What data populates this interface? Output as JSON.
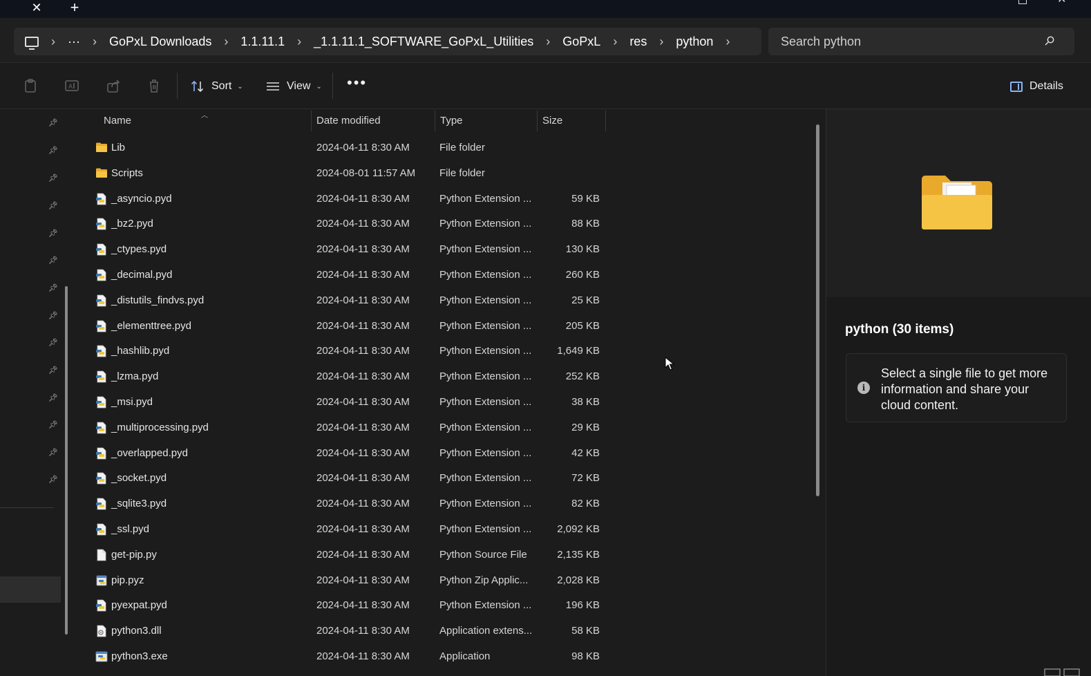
{
  "titlebar": {
    "close_tab_glyph": "✕",
    "new_tab_glyph": "+"
  },
  "address": {
    "more_glyph": "···",
    "breadcrumbs": [
      "GoPxL Downloads",
      "1.1.11.1",
      "_1.1.11.1_SOFTWARE_GoPxL_Utilities",
      "GoPxL",
      "res",
      "python"
    ],
    "separator": "›"
  },
  "search": {
    "placeholder": "Search python"
  },
  "toolbar": {
    "sort_label": "Sort",
    "view_label": "View",
    "more_label": "•••",
    "details_label": "Details"
  },
  "columns": {
    "name": "Name",
    "date": "Date modified",
    "type": "Type",
    "size": "Size"
  },
  "files": [
    {
      "name": "Lib",
      "date": "2024-04-11 8:30 AM",
      "type": "File folder",
      "size": "",
      "icon": "folder-icon"
    },
    {
      "name": "Scripts",
      "date": "2024-08-01 11:57 AM",
      "type": "File folder",
      "size": "",
      "icon": "folder-icon"
    },
    {
      "name": "_asyncio.pyd",
      "date": "2024-04-11 8:30 AM",
      "type": "Python Extension ...",
      "size": "59 KB",
      "icon": "python-file-icon"
    },
    {
      "name": "_bz2.pyd",
      "date": "2024-04-11 8:30 AM",
      "type": "Python Extension ...",
      "size": "88 KB",
      "icon": "python-file-icon"
    },
    {
      "name": "_ctypes.pyd",
      "date": "2024-04-11 8:30 AM",
      "type": "Python Extension ...",
      "size": "130 KB",
      "icon": "python-file-icon"
    },
    {
      "name": "_decimal.pyd",
      "date": "2024-04-11 8:30 AM",
      "type": "Python Extension ...",
      "size": "260 KB",
      "icon": "python-file-icon"
    },
    {
      "name": "_distutils_findvs.pyd",
      "date": "2024-04-11 8:30 AM",
      "type": "Python Extension ...",
      "size": "25 KB",
      "icon": "python-file-icon"
    },
    {
      "name": "_elementtree.pyd",
      "date": "2024-04-11 8:30 AM",
      "type": "Python Extension ...",
      "size": "205 KB",
      "icon": "python-file-icon"
    },
    {
      "name": "_hashlib.pyd",
      "date": "2024-04-11 8:30 AM",
      "type": "Python Extension ...",
      "size": "1,649 KB",
      "icon": "python-file-icon"
    },
    {
      "name": "_lzma.pyd",
      "date": "2024-04-11 8:30 AM",
      "type": "Python Extension ...",
      "size": "252 KB",
      "icon": "python-file-icon"
    },
    {
      "name": "_msi.pyd",
      "date": "2024-04-11 8:30 AM",
      "type": "Python Extension ...",
      "size": "38 KB",
      "icon": "python-file-icon"
    },
    {
      "name": "_multiprocessing.pyd",
      "date": "2024-04-11 8:30 AM",
      "type": "Python Extension ...",
      "size": "29 KB",
      "icon": "python-file-icon"
    },
    {
      "name": "_overlapped.pyd",
      "date": "2024-04-11 8:30 AM",
      "type": "Python Extension ...",
      "size": "42 KB",
      "icon": "python-file-icon"
    },
    {
      "name": "_socket.pyd",
      "date": "2024-04-11 8:30 AM",
      "type": "Python Extension ...",
      "size": "72 KB",
      "icon": "python-file-icon"
    },
    {
      "name": "_sqlite3.pyd",
      "date": "2024-04-11 8:30 AM",
      "type": "Python Extension ...",
      "size": "82 KB",
      "icon": "python-file-icon"
    },
    {
      "name": "_ssl.pyd",
      "date": "2024-04-11 8:30 AM",
      "type": "Python Extension ...",
      "size": "2,092 KB",
      "icon": "python-file-icon"
    },
    {
      "name": "get-pip.py",
      "date": "2024-04-11 8:30 AM",
      "type": "Python Source File",
      "size": "2,135 KB",
      "icon": "blank-file-icon"
    },
    {
      "name": "pip.pyz",
      "date": "2024-04-11 8:30 AM",
      "type": "Python Zip Applic...",
      "size": "2,028 KB",
      "icon": "python-zip-icon"
    },
    {
      "name": "pyexpat.pyd",
      "date": "2024-04-11 8:30 AM",
      "type": "Python Extension ...",
      "size": "196 KB",
      "icon": "python-file-icon"
    },
    {
      "name": "python3.dll",
      "date": "2024-04-11 8:30 AM",
      "type": "Application extens...",
      "size": "58 KB",
      "icon": "dll-file-icon"
    },
    {
      "name": "python3.exe",
      "date": "2024-04-11 8:30 AM",
      "type": "Application",
      "size": "98 KB",
      "icon": "python-exe-icon"
    }
  ],
  "details_pane": {
    "title": "python (30 items)",
    "info_glyph": "i",
    "info_text": "Select a single file to get more information and share your cloud content."
  },
  "colors": {
    "folder": "#f6c445",
    "accent": "#8ab4f8",
    "background": "#1c1c1c"
  }
}
